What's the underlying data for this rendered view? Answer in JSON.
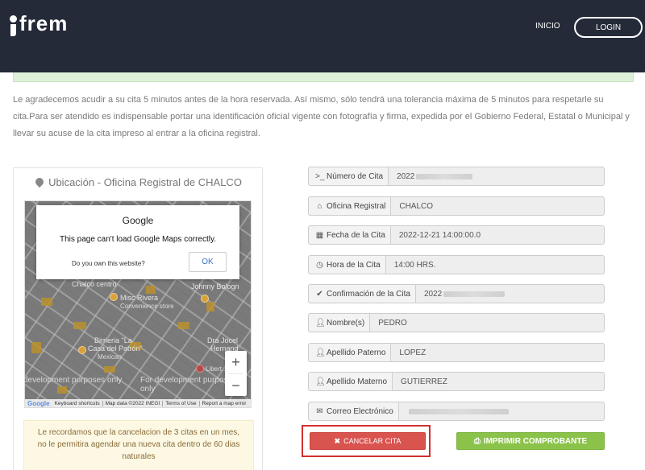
{
  "header": {
    "brand": "frem",
    "nav_inicio": "INICIO",
    "nav_login": "LOGIN"
  },
  "notice": "Le agradecemos acudir a su cita 5 minutos antes de la hora reservada. Así mismo, sólo tendrá una tolerancia máxima de 5 minutos para respetarle su cita.Para ser atendido es indispensable portar una identificación oficial vigente con fotografía y firma, expedida por el Gobierno Federal, Estatal o Municipal y llevar su acuse de la cita impreso al entrar a la oficina registral.",
  "map": {
    "title": "Ubicación - Oficina Registral de CHALCO",
    "dialog_brand": "Google",
    "dialog_message": "This page can't load Google Maps correctly.",
    "dialog_question": "Do you own this website?",
    "dialog_ok": "OK",
    "labels": {
      "chalco_centro": "Chalco centro",
      "misc_rivera": "Misc Rivera",
      "convenience": "Convenience store",
      "johnny": "Johnny Bologn",
      "birrieria": "Birrieria \"La",
      "casa_patron": "Casa del Patrón\"",
      "mexican": "Mexican",
      "dra_jocel": "Dra Jocel",
      "hernand": "Hernand",
      "libertad": "Libert..."
    },
    "dev_text_left": "development purposes only",
    "dev_text_right": "For development purposes only",
    "zoom_in": "+",
    "zoom_out": "−",
    "footer_logo": "Google",
    "footer_shortcuts": "Keyboard shortcuts",
    "footer_mapdata": "Map data ©2022 INEGI",
    "footer_terms": "Terms of Use",
    "footer_report": "Report a map error"
  },
  "reminder": "Le recordamos que la cancelacion de 3 citas en un mes, no le permitira agendar una nueva cita dentro de 60 dias naturales",
  "fields": {
    "numero": {
      "label": "Número de Cita",
      "value": "2022",
      "icon": "terminal-icon"
    },
    "oficina": {
      "label": "Oficina Registral",
      "value": "CHALCO",
      "icon": "home-icon"
    },
    "fecha": {
      "label": "Fecha de la Cita",
      "value": "2022-12-21 14:00:00.0",
      "icon": "calendar-icon"
    },
    "hora": {
      "label": "Hora de la Cita",
      "value": "14:00 HRS.",
      "icon": "clock-icon"
    },
    "confirmacion": {
      "label": "Confirmación de la Cita",
      "value": "2022",
      "icon": "check-icon"
    },
    "nombre": {
      "label": "Nombre(s)",
      "value": "PEDRO",
      "icon": "user-icon"
    },
    "paterno": {
      "label": "Apellido Paterno",
      "value": "LOPEZ",
      "icon": "user-icon"
    },
    "materno": {
      "label": "Apellido Materno",
      "value": "GUTIERREZ",
      "icon": "user-icon"
    },
    "correo": {
      "label": "Correo Electrónico",
      "value": "",
      "icon": "envelope-icon"
    }
  },
  "buttons": {
    "cancel": "CANCELAR CITA",
    "print": "IMPRIMIR COMPROBANTE"
  },
  "colors": {
    "header_bg": "#242a38",
    "cancel": "#d9534f",
    "print": "#8bc34a",
    "highlight": "#d32f2f"
  }
}
